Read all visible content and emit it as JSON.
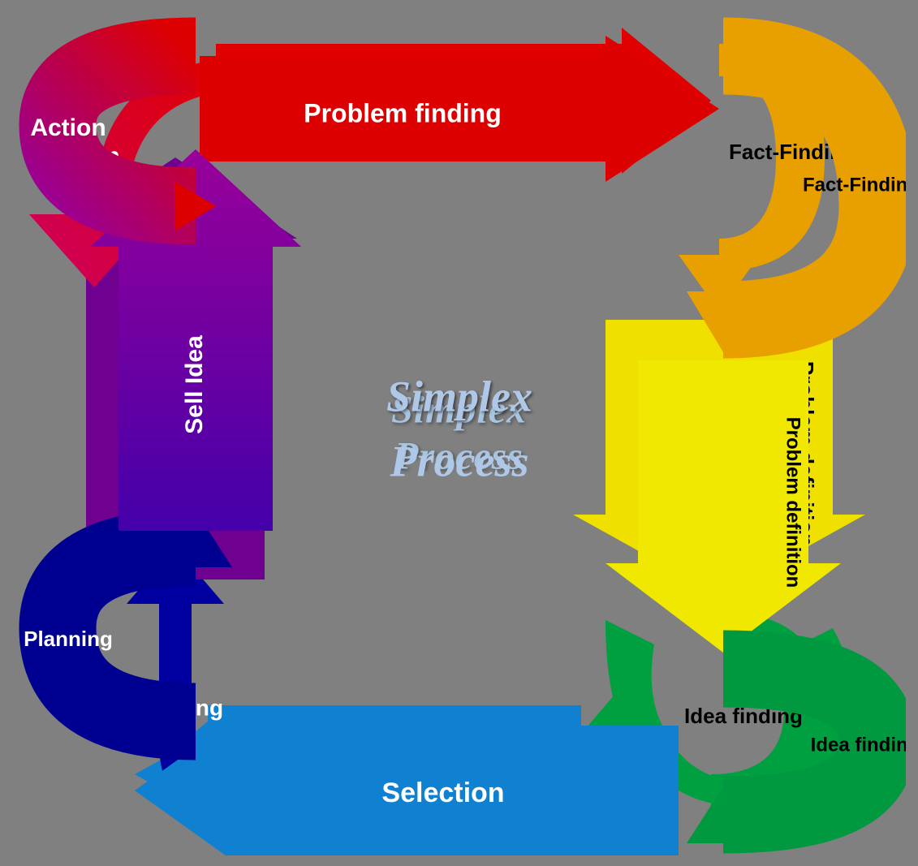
{
  "diagram": {
    "title": "Simplex Process",
    "title_line1": "Simplex",
    "title_line2": "Process",
    "colors": {
      "background": "#808080",
      "problem_finding": "#e00000",
      "fact_finding": "#e8a000",
      "problem_definition": "#f0e000",
      "idea_finding": "#00a040",
      "selection": "#1080d0",
      "planning": "#0000a0",
      "sell_idea": "#700090",
      "action": "#cc0060"
    },
    "arrows": [
      {
        "id": "problem-finding",
        "label": "Problem finding"
      },
      {
        "id": "fact-finding",
        "label": "Fact-Finding"
      },
      {
        "id": "problem-definition",
        "label": "Problem definition"
      },
      {
        "id": "idea-finding",
        "label": "Idea finding"
      },
      {
        "id": "selection",
        "label": "Selection"
      },
      {
        "id": "planning",
        "label": "Planning"
      },
      {
        "id": "sell-idea",
        "label": "Sell Idea"
      },
      {
        "id": "action",
        "label": "Action"
      }
    ]
  }
}
